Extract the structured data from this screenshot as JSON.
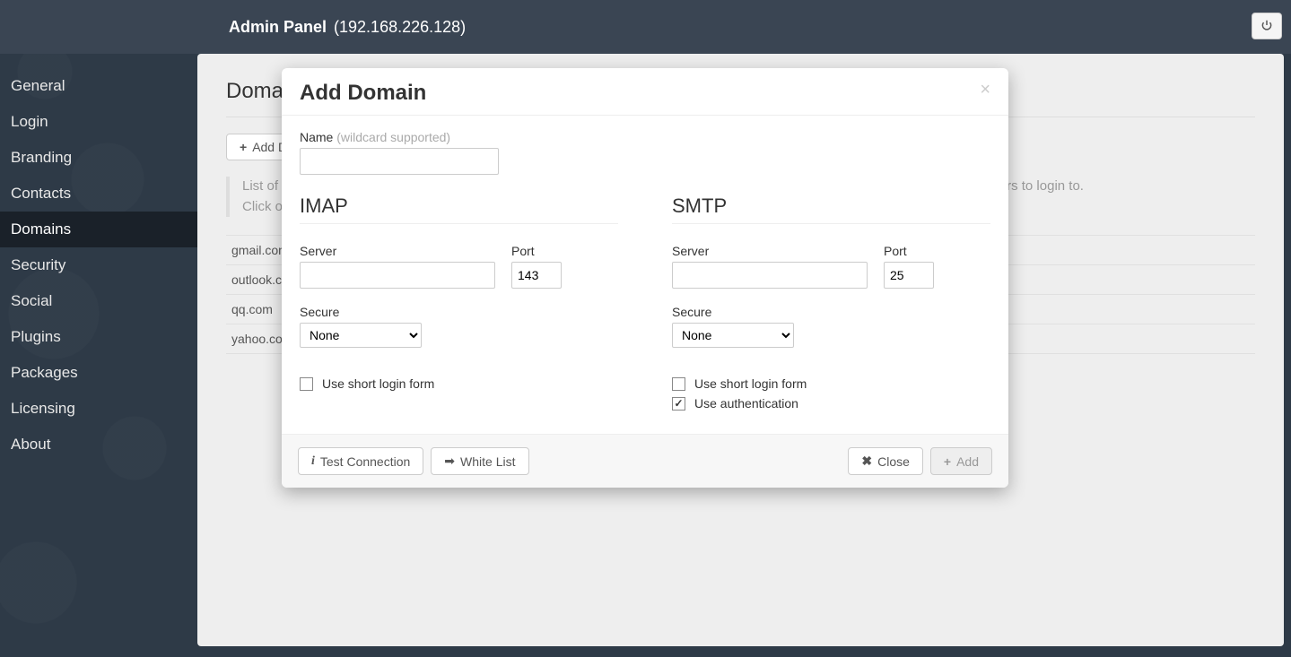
{
  "header": {
    "title": "Admin Panel",
    "ip": "(192.168.226.128)"
  },
  "sidebar": {
    "items": [
      {
        "label": "General"
      },
      {
        "label": "Login"
      },
      {
        "label": "Branding"
      },
      {
        "label": "Contacts"
      },
      {
        "label": "Domains"
      },
      {
        "label": "Security"
      },
      {
        "label": "Social"
      },
      {
        "label": "Plugins"
      },
      {
        "label": "Packages"
      },
      {
        "label": "Licensing"
      },
      {
        "label": "About"
      }
    ],
    "active_index": 4
  },
  "page": {
    "title": "Domains",
    "add_button": "Add Domain",
    "help_line1": "List of domains webmail will allow logging in to. Each domain must be individually configured so that webmail knows which servers to login to.",
    "help_line2": "Click on domain name to configure.",
    "domains": [
      "gmail.com",
      "outlook.com",
      "qq.com",
      "yahoo.com"
    ]
  },
  "modal": {
    "title": "Add Domain",
    "name_label": "Name",
    "name_hint": "(wildcard supported)",
    "name_value": "",
    "imap": {
      "heading": "IMAP",
      "server_label": "Server",
      "server_value": "",
      "port_label": "Port",
      "port_value": "143",
      "secure_label": "Secure",
      "secure_value": "None",
      "short_login_label": "Use short login form",
      "short_login_checked": false
    },
    "smtp": {
      "heading": "SMTP",
      "server_label": "Server",
      "server_value": "",
      "port_label": "Port",
      "port_value": "25",
      "secure_label": "Secure",
      "secure_value": "None",
      "short_login_label": "Use short login form",
      "short_login_checked": false,
      "auth_label": "Use authentication",
      "auth_checked": true
    },
    "footer": {
      "test": "Test Connection",
      "whitelist": "White List",
      "close": "Close",
      "add": "Add"
    }
  }
}
